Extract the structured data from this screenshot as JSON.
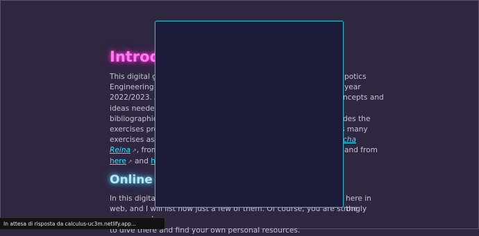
{
  "heading_intro": "Introduction",
  "intro": {
    "line1": "This digital ga",
    "line1_r": "potics",
    "line2": "Engineering a",
    "line2_r": "year",
    "line3": "2022/2023. As",
    "line3_r": "ncepts and",
    "line4": "ideas needed",
    "line5": "bibliographic",
    "line5_r": "ides the",
    "line6": "exercises prov",
    "line6_r": "s many",
    "line7": "exercises as p",
    "line7_r": "icha",
    "line8_a": "Reina",
    "line8_b": ", from",
    "line8_r": "and from",
    "line9_a": "here",
    "line9_b": " and ",
    "line9_c": "he"
  },
  "heading_online": "Online re",
  "online": {
    "line1": "In this digital",
    "line1_r": "here in the",
    "line2": "web, and I will list now just a few of them. Of course, you are strongly encouraged",
    "line3": "to dive there and find your own personal resources."
  },
  "status_bar": "In attesa di risposta da calculus-uc3m.netlify.app..."
}
